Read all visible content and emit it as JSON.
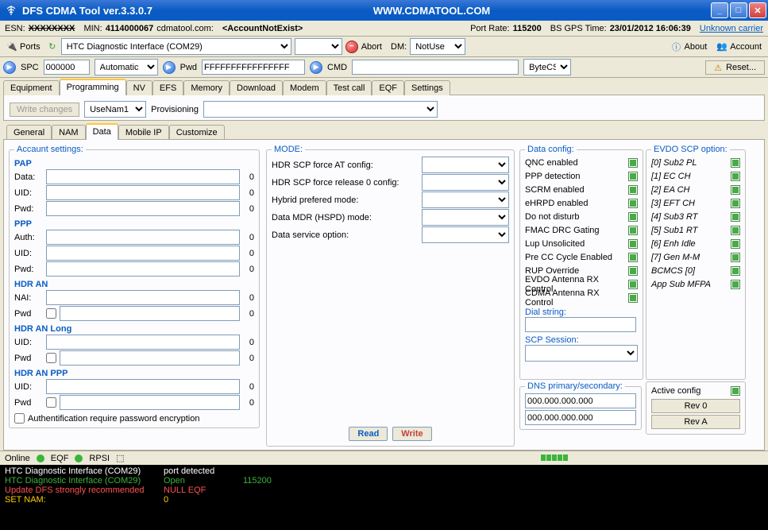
{
  "titlebar": {
    "title": "DFS CDMA Tool ver.3.3.0.7",
    "url": "WWW.CDMATOOL.COM"
  },
  "status1": {
    "esn_label": "ESN:",
    "esn_value": "XXXXXXXX",
    "min_label": "MIN:",
    "min_value": "4114000067",
    "domain": "cdmatool.com:",
    "account": "<AccountNotExist>",
    "portrate_label": "Port Rate:",
    "portrate_value": "115200",
    "bsgps_label": "BS GPS Time:",
    "bsgps_value": "23/01/2012 16:06:39",
    "carrier": "Unknown carrier"
  },
  "toolbar": {
    "ports": "Ports",
    "interface": "HTC Diagnostic Interface (COM29)",
    "abort": "Abort",
    "dm": "DM:",
    "dm_value": "NotUse",
    "about": "About",
    "account": "Account"
  },
  "toolbar2": {
    "spc": "SPC",
    "spc_value": "000000",
    "spc_mode": "Automatic",
    "pwd": "Pwd",
    "pwd_value": "FFFFFFFFFFFFFFFF",
    "cmd": "CMD",
    "bytecs": "ByteCS",
    "reset": "Reset..."
  },
  "tabs": {
    "main": [
      "Equipment",
      "Programming",
      "NV",
      "EFS",
      "Memory",
      "Download",
      "Modem",
      "Test call",
      "EQF",
      "Settings"
    ],
    "main_active": 1
  },
  "subbar": {
    "write_changes": "Write changes",
    "nam": "UseNam1",
    "provisioning": "Provisioning"
  },
  "subtabs": {
    "items": [
      "General",
      "NAM",
      "Data",
      "Mobile IP",
      "Customize"
    ],
    "active": 2
  },
  "account": {
    "title": "Accaunt settings:",
    "pap": {
      "title": "PAP",
      "data": "Data:",
      "uid": "UID:",
      "pwd": "Pwd:"
    },
    "ppp": {
      "title": "PPP",
      "auth": "Auth:",
      "uid": "UID:",
      "pwd": "Pwd:"
    },
    "hdran": {
      "title": "HDR AN",
      "nai": "NAI:",
      "pwd": "Pwd"
    },
    "hdranlong": {
      "title": "HDR AN Long",
      "uid": "UID:",
      "pwd": "Pwd"
    },
    "hdranppp": {
      "title": "HDR AN PPP",
      "uid": "UID:",
      "pwd": "Pwd"
    },
    "enc": "Authentification require password encryption",
    "zero": "0"
  },
  "mode": {
    "title": "MODE:",
    "items": [
      "HDR SCP force AT config:",
      "HDR SCP force release 0 config:",
      "Hybrid prefered mode:",
      "Data MDR (HSPD) mode:",
      "Data service option:"
    ]
  },
  "actions": {
    "read": "Read",
    "write": "Write"
  },
  "dataconfig": {
    "title": "Data config:",
    "items": [
      "QNC enabled",
      "PPP detection",
      "SCRM enabled",
      "eHRPD enabled",
      "Do not disturb",
      "FMAC DRC Gating",
      "Lup Unsolicited",
      "Pre CC Cycle Enabled",
      "RUP Override",
      "EVDO Antenna RX Control",
      "CDMA Antenna RX Control"
    ],
    "dial": "Dial string:",
    "scp": "SCP Session:",
    "dns": "DNS primary/secondary:",
    "dns1": "000.000.000.000",
    "dns2": "000.000.000.000"
  },
  "evdo": {
    "title": "EVDO SCP option:",
    "items": [
      "[0] Sub2 PL",
      "[1] EC CH",
      "[2] EA CH",
      "[3] EFT CH",
      "[4] Sub3 RT",
      "[5] Sub1 RT",
      "[6] Enh Idle",
      "[7] Gen M-M",
      "BCMCS [0]",
      "App Sub MFPA"
    ],
    "active": "Active config",
    "rev0": "Rev 0",
    "reva": "Rev A"
  },
  "bottom": {
    "online": "Online",
    "eqf": "EQF",
    "rpsi": "RPSI"
  },
  "console": [
    {
      "c1": "HTC Diagnostic Interface (COM29)",
      "c2": "port detected",
      "c3": "",
      "cls": ""
    },
    {
      "c1": "HTC Diagnostic Interface (COM29)",
      "c2": "Open",
      "c3": "115200",
      "cls": "green"
    },
    {
      "c1": "Update DFS strongly recommended",
      "c2": "NULL EQF",
      "c3": "",
      "cls": "red"
    },
    {
      "c1": "SET NAM:",
      "c2": "0",
      "c3": "",
      "cls": "yellow"
    }
  ]
}
